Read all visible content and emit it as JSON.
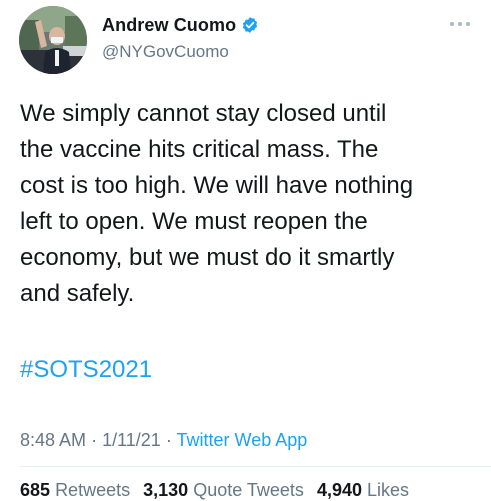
{
  "author": {
    "display_name": "Andrew Cuomo",
    "handle": "@NYGovCuomo",
    "verified": true,
    "avatar_icon": "profile-photo"
  },
  "tweet": {
    "text": "We simply cannot stay closed until\nthe vaccine hits critical mass. The\ncost is too high. We will have nothing\nleft to open. We must reopen the\neconomy, but we must do it smartly\nand safely.",
    "hashtag": "#SOTS2021"
  },
  "meta": {
    "time": "8:48 AM",
    "sep1": "·",
    "date": "1/11/21",
    "sep2": "·",
    "source": "Twitter Web App"
  },
  "stats": {
    "retweets_count": "685",
    "retweets_label": "Retweets",
    "quotes_count": "3,130",
    "quotes_label": "Quote Tweets",
    "likes_count": "4,940",
    "likes_label": "Likes"
  },
  "colors": {
    "link_blue": "#1da1f2",
    "secondary_gray": "#657786",
    "text": "#14171a"
  },
  "icons": {
    "verified": "verified-badge-icon",
    "more": "more-options-icon"
  }
}
